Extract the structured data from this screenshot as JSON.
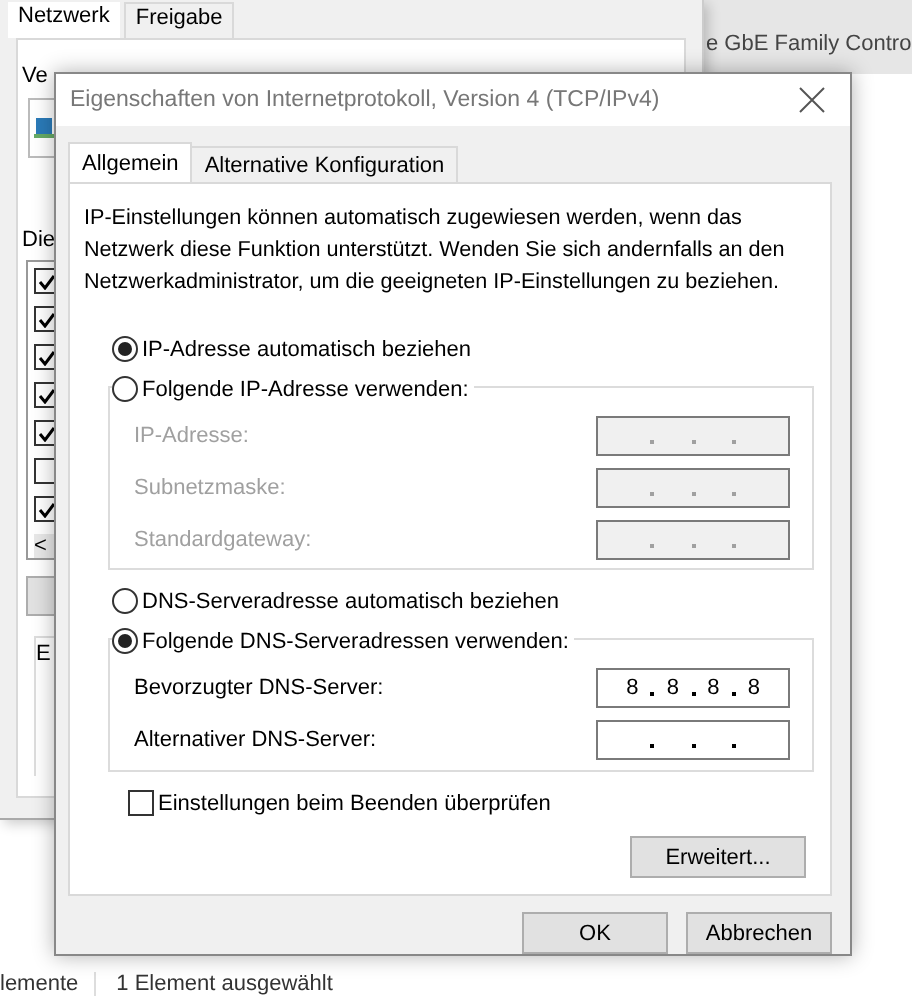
{
  "background_window": {
    "tabs": [
      {
        "label": "Netzwerk",
        "selected": true
      },
      {
        "label": "Freigabe",
        "selected": false
      }
    ],
    "connect_label": "Ve",
    "list_label": "Die",
    "components": [
      {
        "checked": true
      },
      {
        "checked": true
      },
      {
        "checked": true
      },
      {
        "checked": true
      },
      {
        "checked": true
      },
      {
        "checked": false
      },
      {
        "checked": true
      }
    ],
    "scroll_arrow": "<",
    "group_label": "E"
  },
  "adapter_name": "e GbE Family Contro",
  "status_bar": {
    "item_count": "lemente",
    "selection": "1 Element ausgewählt"
  },
  "dialog": {
    "title": "Eigenschaften von Internetprotokoll, Version 4 (TCP/IPv4)",
    "tabs": [
      {
        "label": "Allgemein",
        "selected": true
      },
      {
        "label": "Alternative Konfiguration",
        "selected": false
      }
    ],
    "description": "IP-Einstellungen können automatisch zugewiesen werden, wenn das\nNetzwerk diese Funktion unterstützt. Wenden Sie sich andernfalls an den\nNetzwerkadministrator, um die geeigneten IP-Einstellungen zu beziehen.",
    "ip_options": [
      {
        "label": "IP-Adresse automatisch beziehen",
        "selected": true
      },
      {
        "label": "Folgende IP-Adresse verwenden:",
        "selected": false
      }
    ],
    "ip_fields": [
      {
        "label": "IP-Adresse:",
        "disabled": true
      },
      {
        "label": "Subnetzmaske:",
        "disabled": true
      },
      {
        "label": "Standardgateway:",
        "disabled": true
      }
    ],
    "dns_options": [
      {
        "label": "DNS-Serveradresse automatisch beziehen",
        "selected": false
      },
      {
        "label": "Folgende DNS-Serveradressen verwenden:",
        "selected": true
      }
    ],
    "dns_fields": [
      {
        "label": "Bevorzugter DNS-Server:",
        "octets": [
          "8",
          "8",
          "8",
          "8"
        ],
        "disabled": false
      },
      {
        "label": "Alternativer DNS-Server:",
        "disabled": false
      }
    ],
    "validate": {
      "label": "Einstellungen beim Beenden überprüfen",
      "checked": false
    },
    "advanced_button": "Erweitert...",
    "buttons": [
      "OK",
      "Abbrechen"
    ]
  }
}
